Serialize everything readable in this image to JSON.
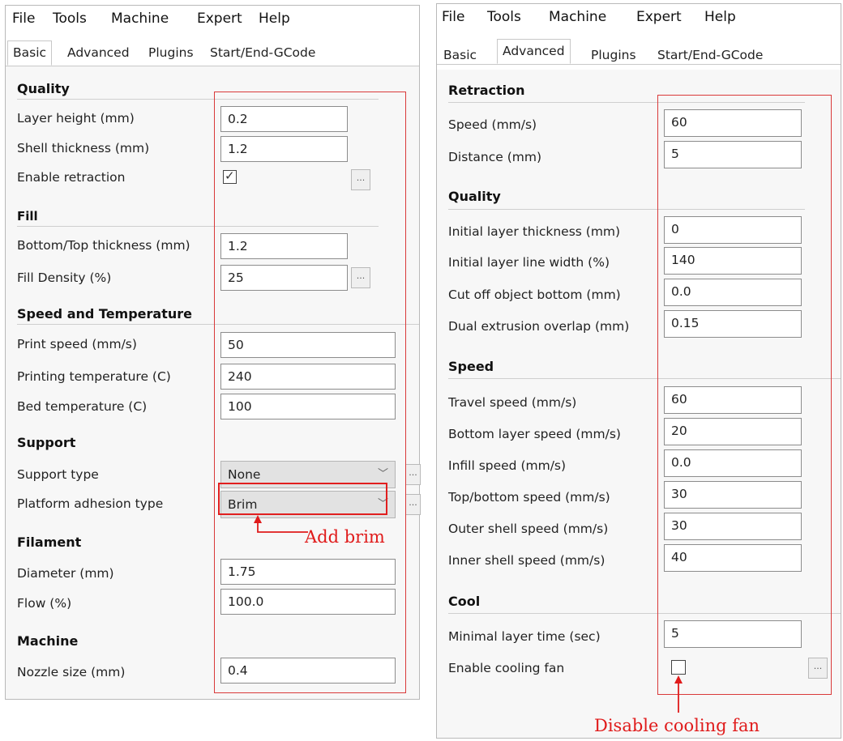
{
  "left": {
    "menu": [
      "File",
      "Tools",
      "Machine",
      "Expert",
      "Help"
    ],
    "tabs": [
      "Basic",
      "Advanced",
      "Plugins",
      "Start/End-GCode"
    ],
    "active_tab": "Basic",
    "sections": {
      "quality": {
        "title": "Quality",
        "layer_height": {
          "label": "Layer height (mm)",
          "value": "0.2"
        },
        "shell_thickness": {
          "label": "Shell thickness (mm)",
          "value": "1.2"
        },
        "enable_retraction": {
          "label": "Enable retraction",
          "checked": true,
          "btn": "..."
        }
      },
      "fill": {
        "title": "Fill",
        "bottom_top": {
          "label": "Bottom/Top thickness (mm)",
          "value": "1.2"
        },
        "fill_density": {
          "label": "Fill Density (%)",
          "value": "25",
          "btn": "..."
        }
      },
      "speed_temp": {
        "title": "Speed and Temperature",
        "print_speed": {
          "label": "Print speed (mm/s)",
          "value": "50"
        },
        "printing_temp": {
          "label": "Printing temperature (C)",
          "value": "240"
        },
        "bed_temp": {
          "label": "Bed temperature (C)",
          "value": "100"
        }
      },
      "support": {
        "title": "Support",
        "support_type": {
          "label": "Support type",
          "value": "None",
          "btn": "..."
        },
        "platform_adhesion": {
          "label": "Platform adhesion type",
          "value": "Brim",
          "btn": "..."
        }
      },
      "filament": {
        "title": "Filament",
        "diameter": {
          "label": "Diameter (mm)",
          "value": "1.75"
        },
        "flow": {
          "label": "Flow (%)",
          "value": "100.0"
        }
      },
      "machine": {
        "title": "Machine",
        "nozzle": {
          "label": "Nozzle size (mm)",
          "value": "0.4"
        }
      }
    },
    "annotation": "Add brim"
  },
  "right": {
    "menu": [
      "File",
      "Tools",
      "Machine",
      "Expert",
      "Help"
    ],
    "tabs": [
      "Basic",
      "Advanced",
      "Plugins",
      "Start/End-GCode"
    ],
    "active_tab": "Advanced",
    "sections": {
      "retraction": {
        "title": "Retraction",
        "speed": {
          "label": "Speed (mm/s)",
          "value": "60"
        },
        "distance": {
          "label": "Distance (mm)",
          "value": "5"
        }
      },
      "quality": {
        "title": "Quality",
        "initial_layer_thickness": {
          "label": "Initial layer thickness (mm)",
          "value": "0"
        },
        "initial_layer_line_width": {
          "label": "Initial layer line width (%)",
          "value": "140"
        },
        "cut_off_bottom": {
          "label": "Cut off object bottom (mm)",
          "value": "0.0"
        },
        "dual_extrusion_overlap": {
          "label": "Dual extrusion overlap (mm)",
          "value": "0.15"
        }
      },
      "speed": {
        "title": "Speed",
        "travel": {
          "label": "Travel speed (mm/s)",
          "value": "60"
        },
        "bottom_layer": {
          "label": "Bottom layer speed (mm/s)",
          "value": "20"
        },
        "infill": {
          "label": "Infill speed (mm/s)",
          "value": "0.0"
        },
        "top_bottom": {
          "label": "Top/bottom speed (mm/s)",
          "value": "30"
        },
        "outer_shell": {
          "label": "Outer shell speed (mm/s)",
          "value": "30"
        },
        "inner_shell": {
          "label": "Inner shell speed (mm/s)",
          "value": "40"
        }
      },
      "cool": {
        "title": "Cool",
        "minimal_layer_time": {
          "label": "Minimal layer time (sec)",
          "value": "5"
        },
        "cooling_fan": {
          "label": "Enable cooling fan",
          "checked": false,
          "btn": "..."
        }
      }
    },
    "annotation": "Disable cooling fan"
  },
  "colors": {
    "annotation": "#e01b1b",
    "panel_bg": "#f7f7f7",
    "field_border": "#8c8c8c"
  }
}
